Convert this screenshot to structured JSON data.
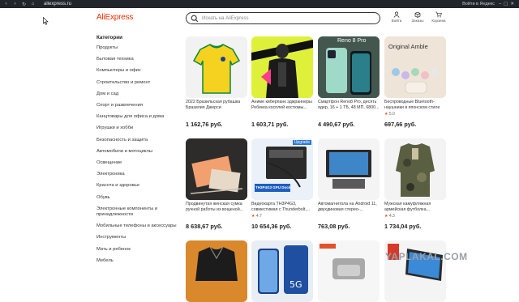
{
  "browser": {
    "url": "aliexpress.ru",
    "signin_label": "Войти в Яндекс"
  },
  "header": {
    "logo": "AliExpress",
    "search_placeholder": "Искать на AliExpress",
    "actions": [
      {
        "label": "Войти",
        "icon": "user-icon"
      },
      {
        "label": "Заказы",
        "icon": "box-icon"
      },
      {
        "label": "Корзина",
        "icon": "cart-icon"
      }
    ],
    "accent_color": "#e62e04"
  },
  "sidebar": {
    "title": "Категории",
    "items": [
      "Продукты",
      "Бытовая техника",
      "Компьютеры и офис",
      "Строительство и ремонт",
      "Дом и сад",
      "Спорт и развлечения",
      "Канцтовары для офиса и дома",
      "Игрушки и хобби",
      "Безопасность и защита",
      "Автомобили и мотоциклы",
      "Освещение",
      "Электроника",
      "Красота и здоровье",
      "Обувь",
      "Электронные компоненты и принадлежности",
      "Мобильные телефоны и аксессуары",
      "Инструменты",
      "Мать и ребенок",
      "Мебель"
    ]
  },
  "products": [
    {
      "name": "2022 Бразильская рубашка Бразилия Джерси",
      "price": "1 162,76 руб.",
      "rating": ""
    },
    {
      "name": "Аниме киберпанк эджраннеры Ребекка косплей костюмы...",
      "price": "1 603,71 руб.",
      "rating": ""
    },
    {
      "name": "Смартфон Reno8 Pro, десять ядер, 16 + 1 ТБ, 48 МП, 6800...",
      "price": "4 490,67 руб.",
      "rating": "",
      "badge": "Reno 8 Pro"
    },
    {
      "name": "Беспроводные Bluetooth-наушники в японском стиле",
      "price": "697,66 руб.",
      "rating": "5.0",
      "badge": "Original Amble"
    },
    {
      "name": "Продвинутая женская сумка ручной работы из вощеной...",
      "price": "8 638,67 руб.",
      "rating": ""
    },
    {
      "name": "Видеокарта TH3P4G3, совместимая с Thunderbolt,...",
      "price": "10 654,36 руб.",
      "rating": "4.7",
      "badge": "Upgrade",
      "sub_badge": "TH3P4G3 GPU Dock"
    },
    {
      "name": "Автомагнитола на Android 11, двухдиновая стерео-...",
      "price": "763,08 руб.",
      "rating": ""
    },
    {
      "name": "Мужская камуфляжная армейская футболка...",
      "price": "1 734,04 руб.",
      "rating": "4.3"
    }
  ],
  "watermark": "YAPLAKAL.COM"
}
